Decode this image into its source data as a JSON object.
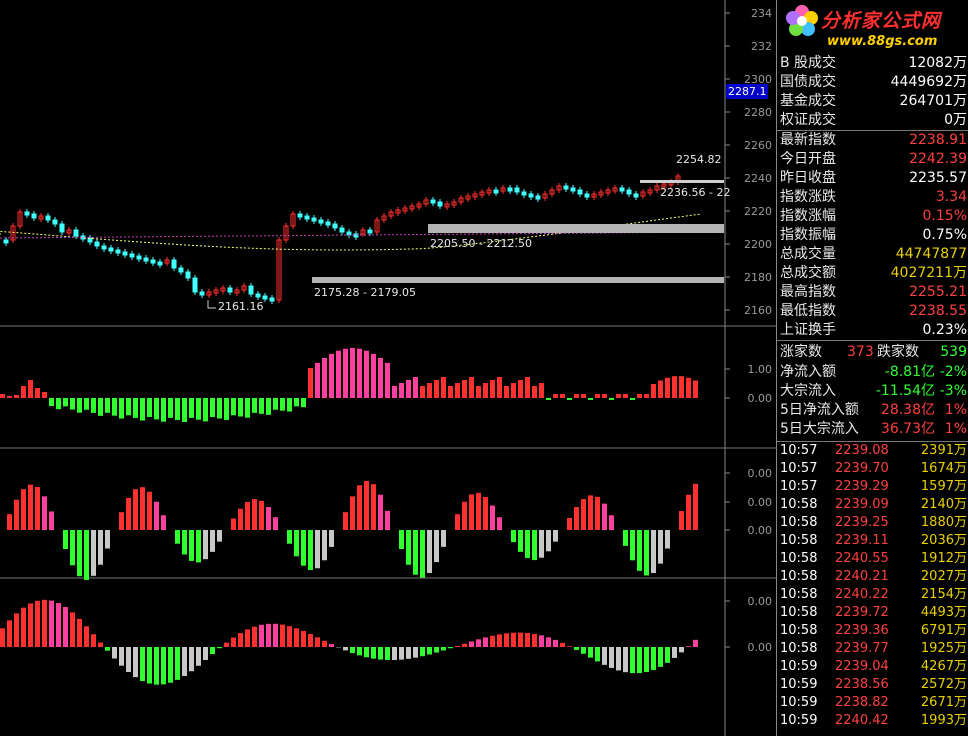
{
  "logo": {
    "title": "分析家公式网",
    "url": "www.88gs.com"
  },
  "price_axis": {
    "ticks": [
      "234",
      "232",
      "2300",
      "2280",
      "2260",
      "2240",
      "2220",
      "2200",
      "2180",
      "2160"
    ],
    "current_flag": "2287.1"
  },
  "indicator_axes": {
    "panel1": [
      "1.00",
      "0.00"
    ],
    "panel2": [
      "0.00",
      "0.00",
      "0.00"
    ],
    "panel3": [
      "0.00",
      "0.00"
    ]
  },
  "annotations": {
    "high": "2254.82",
    "upper_band": "2236.56 - 22",
    "mid_band": "2205.50 - 2212.50",
    "low_band": "2175.28 - 2179.05",
    "low": "2161.16"
  },
  "stats": [
    {
      "label": "B 股成交",
      "value": "12082万",
      "color": "white"
    },
    {
      "label": "国债成交",
      "value": "4449692万",
      "color": "white"
    },
    {
      "label": "基金成交",
      "value": "264701万",
      "color": "white"
    },
    {
      "label": "权证成交",
      "value": "0万",
      "color": "white"
    },
    {
      "label": "最新指数",
      "value": "2238.91",
      "color": "red"
    },
    {
      "label": "今日开盘",
      "value": "2242.39",
      "color": "red"
    },
    {
      "label": "昨日收盘",
      "value": "2235.57",
      "color": "white"
    },
    {
      "label": "指数涨跌",
      "value": "3.34",
      "color": "red"
    },
    {
      "label": "指数涨幅",
      "value": "0.15%",
      "color": "red"
    },
    {
      "label": "指数振幅",
      "value": "0.75%",
      "color": "white"
    },
    {
      "label": "总成交量",
      "value": "44747877",
      "color": "yellow"
    },
    {
      "label": "总成交额",
      "value": "4027211万",
      "color": "yellow"
    },
    {
      "label": "最高指数",
      "value": "2255.21",
      "color": "red"
    },
    {
      "label": "最低指数",
      "value": "2238.55",
      "color": "red"
    },
    {
      "label": "上证换手",
      "value": "0.23%",
      "color": "white"
    }
  ],
  "breadth": {
    "up_label": "涨家数",
    "up_value": "373",
    "down_label": "跌家数",
    "down_value": "539"
  },
  "flows": [
    {
      "label": "净流入额",
      "amount": "-8.81亿",
      "pct": "-2%",
      "color": "green"
    },
    {
      "label": "大宗流入",
      "amount": "-11.54亿",
      "pct": "-3%",
      "color": "green"
    },
    {
      "label": "5日净流入额",
      "amount": "28.38亿",
      "pct": "1%",
      "color": "red"
    },
    {
      "label": "5日大宗流入",
      "amount": "36.73亿",
      "pct": "1%",
      "color": "red"
    }
  ],
  "ticks": [
    {
      "time": "10:57",
      "price": "2239.08",
      "vol": "2391万"
    },
    {
      "time": "10:57",
      "price": "2239.70",
      "vol": "1674万"
    },
    {
      "time": "10:57",
      "price": "2239.29",
      "vol": "1597万"
    },
    {
      "time": "10:58",
      "price": "2239.09",
      "vol": "2140万"
    },
    {
      "time": "10:58",
      "price": "2239.25",
      "vol": "1880万"
    },
    {
      "time": "10:58",
      "price": "2239.11",
      "vol": "2036万"
    },
    {
      "time": "10:58",
      "price": "2240.55",
      "vol": "1912万"
    },
    {
      "time": "10:58",
      "price": "2240.21",
      "vol": "2027万"
    },
    {
      "time": "10:58",
      "price": "2240.22",
      "vol": "2154万"
    },
    {
      "time": "10:58",
      "price": "2239.72",
      "vol": "4493万"
    },
    {
      "time": "10:58",
      "price": "2239.36",
      "vol": "6791万"
    },
    {
      "time": "10:58",
      "price": "2239.77",
      "vol": "1925万"
    },
    {
      "time": "10:59",
      "price": "2239.04",
      "vol": "4267万"
    },
    {
      "time": "10:59",
      "price": "2238.56",
      "vol": "2572万"
    },
    {
      "time": "10:59",
      "price": "2238.82",
      "vol": "2671万"
    },
    {
      "time": "10:59",
      "price": "2240.42",
      "vol": "1993万"
    }
  ],
  "colors": {
    "up": "#ff3030",
    "down": "#40ffff",
    "pink": "#ff40a0",
    "green": "#30ff30",
    "grey": "#c8c8c8"
  }
}
